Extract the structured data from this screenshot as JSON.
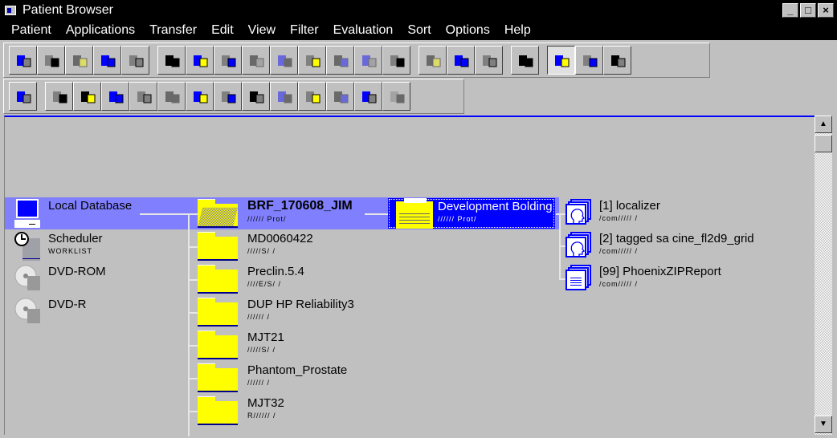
{
  "window": {
    "title": "Patient Browser",
    "buttons": [
      "_",
      "□",
      "×"
    ]
  },
  "menu": [
    "Patient",
    "Applications",
    "Transfer",
    "Edit",
    "View",
    "Filter",
    "Evaluation",
    "Sort",
    "Options",
    "Help"
  ],
  "menu_underline": [
    "P",
    "A",
    "T",
    "E",
    "V",
    "F",
    "u",
    "r",
    "O",
    "H"
  ],
  "toolbar1": [
    {
      "icon": "register-patient-icon"
    },
    {
      "icon": "patient-info-icon"
    },
    {
      "icon": "merge-icon",
      "disabled": true
    },
    {
      "icon": "correct-icon"
    },
    {
      "icon": "edit-patient-icon"
    },
    {
      "icon": "viewer-icon"
    },
    {
      "icon": "send-icon"
    },
    {
      "icon": "document-icon"
    },
    {
      "icon": "noise-icon",
      "disabled": true
    },
    {
      "icon": "circle-icon",
      "disabled": true
    },
    {
      "icon": "tree-icon"
    },
    {
      "icon": "pen-icon",
      "disabled": true
    },
    {
      "icon": "trash-icon",
      "disabled": true
    },
    {
      "icon": "network-icon"
    },
    {
      "icon": "tree-view-icon",
      "disabled": true
    },
    {
      "icon": "cut-icon"
    },
    {
      "icon": "delete-icon"
    },
    {
      "icon": "refresh-icon"
    },
    {
      "icon": "close-view-icon",
      "pressed": true
    },
    {
      "icon": "camera-icon"
    },
    {
      "icon": "transfer-icon"
    }
  ],
  "toolbar2": [
    {
      "icon": "checklist-icon"
    },
    {
      "icon": "import-icon"
    },
    {
      "icon": "export-icon"
    },
    {
      "icon": "grid-icon"
    },
    {
      "icon": "query-icon"
    },
    {
      "icon": "archive-icon",
      "disabled": true
    },
    {
      "icon": "verify-icon"
    },
    {
      "icon": "copy-local-icon"
    },
    {
      "icon": "copy-net-icon"
    },
    {
      "icon": "send-print-icon",
      "disabled": true
    },
    {
      "icon": "queue-icon"
    },
    {
      "icon": "filter-icon",
      "disabled": true
    },
    {
      "icon": "query-retrieve-icon"
    },
    {
      "icon": "help-icon",
      "disabled": true
    }
  ],
  "sources": [
    {
      "label": "Local Database",
      "sub": "",
      "icon": "monitor-icon",
      "selected": true
    },
    {
      "label": "Scheduler",
      "sub": "WORKLIST",
      "icon": "clock-icon"
    },
    {
      "label": "DVD-ROM",
      "sub": "",
      "icon": "dvd-icon"
    },
    {
      "label": "DVD-R",
      "sub": "",
      "icon": "dvd-icon"
    }
  ],
  "patients": [
    {
      "label": "BRF_170608_JIM",
      "sub": "////// Prot/",
      "selected": true
    },
    {
      "label": "MD0060422",
      "sub": "/////S/  /"
    },
    {
      "label": "Preclin.5.4",
      "sub": "////E/S/  /"
    },
    {
      "label": "DUP HP Reliability3",
      "sub": "//////  /"
    },
    {
      "label": "MJT21",
      "sub": "/////S/  /"
    },
    {
      "label": "Phantom_Prostate",
      "sub": "//////  /"
    },
    {
      "label": "MJT32",
      "sub": "R//////  /"
    }
  ],
  "study": {
    "label": "Development Bolding",
    "sub": "////// Prot/"
  },
  "series": [
    {
      "label": "[1] localizer",
      "sub": "/com/////  /",
      "icon": "head-image-icon"
    },
    {
      "label": "[2] tagged sa cine_fl2d9_grid",
      "sub": "/com/////  /",
      "icon": "head-image-icon"
    },
    {
      "label": "[99] PhoenixZIPReport",
      "sub": "/com/////  /",
      "icon": "report-icon"
    }
  ],
  "colors": {
    "selection": "#8080ff",
    "study_selected": "#0000ff",
    "folder": "#ffff00"
  }
}
